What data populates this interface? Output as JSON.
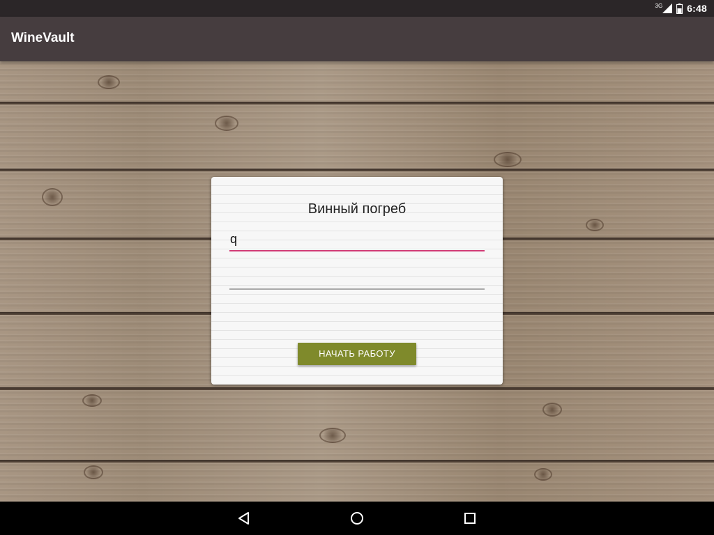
{
  "status_bar": {
    "network_type": "3G",
    "time": "6:48",
    "icons": [
      "signal-icon",
      "battery-icon"
    ]
  },
  "app_bar": {
    "title": "WineVault",
    "background": "#463d3f"
  },
  "login_card": {
    "title": "Винный погреб",
    "login_field": {
      "value": "q",
      "placeholder": "",
      "accent_color": "#d23b76"
    },
    "password_field": {
      "value": "",
      "placeholder": ""
    },
    "start_button": {
      "label": "НАЧАТЬ РАБОТУ",
      "color": "#7f8a2b"
    }
  },
  "nav_bar": {
    "icons": [
      "back-icon",
      "home-icon",
      "recents-icon"
    ]
  }
}
